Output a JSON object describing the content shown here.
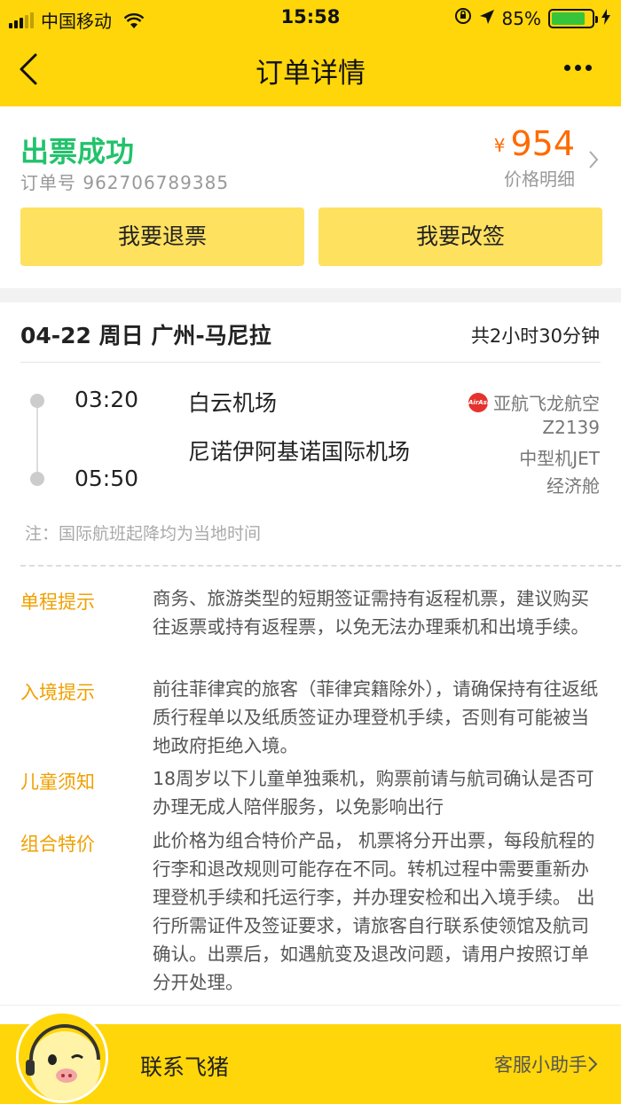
{
  "status_bar": {
    "carrier": "中国移动",
    "time": "15:58",
    "battery": "85%"
  },
  "nav": {
    "title": "订单详情"
  },
  "order": {
    "status": "出票成功",
    "order_no": "订单号 962706789385",
    "currency": "¥",
    "price": "954",
    "price_detail": "价格明细",
    "refund_button": "我要退票",
    "change_button": "我要改签"
  },
  "flight": {
    "route": "04-22 周日 广州-马尼拉",
    "duration": "共2小时30分钟",
    "dep_time": "03:20",
    "dep_airport": "白云机场",
    "arr_time": "05:50",
    "arr_airport": "尼诺伊阿基诺国际机场",
    "airline_logo": "AirAsia",
    "airline": "亚航飞龙航空",
    "flight_no": "Z2139",
    "aircraft": "中型机JET",
    "cabin": "经济舱",
    "note": "注：国际航班起降均为当地时间"
  },
  "tips": [
    {
      "label": "单程提示",
      "text": "商务、旅游类型的短期签证需持有返程机票，建议购买往返票或持有返程票，以免无法办理乘机和出境手续。"
    },
    {
      "label": "入境提示",
      "text": "前往菲律宾的旅客（菲律宾籍除外），请确保持有往返纸质行程单以及纸质签证办理登机手续，否则有可能被当地政府拒绝入境。"
    },
    {
      "label": "儿童须知",
      "text": "18周岁以下儿童单独乘机，购票前请与航司确认是否可办理无成人陪伴服务，以免影响出行"
    },
    {
      "label": "组合特价",
      "text": "此价格为组合特价产品， 机票将分开出票，每段航程的行李和退改规则可能存在不同。转机过程中需要重新办理登机手续和托运行李，并办理安检和出入境手续。 出行所需证件及签证要求，请旅客自行联系使领馆及航司确认。出票后，如遇航变及退改问题，请用户按照订单分开处理。"
    }
  ],
  "bottom": {
    "contact": "联系飞猪",
    "assistant": "客服小助手"
  },
  "colors": {
    "brand_yellow": "#ffd60a",
    "button_yellow": "#ffe160",
    "success_green": "#22c26b",
    "price_orange": "#ff6a00",
    "tip_orange": "#f0a000"
  }
}
